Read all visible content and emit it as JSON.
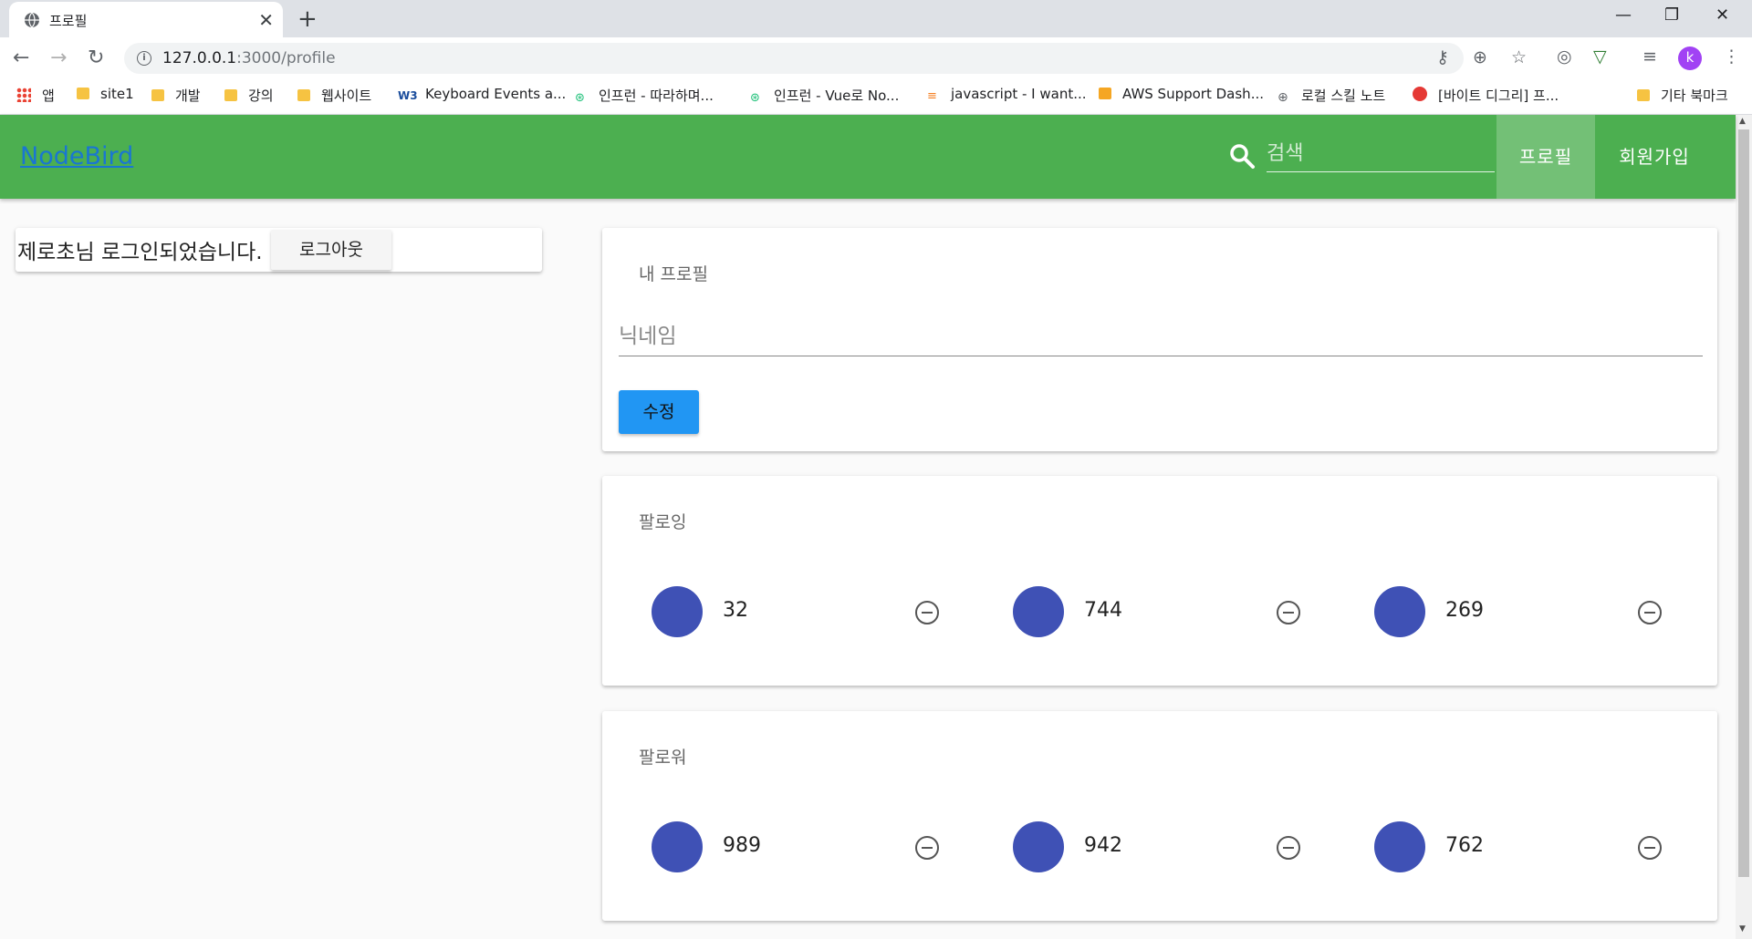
{
  "browser": {
    "tab_title": "프로필",
    "url_host": "127.0.0.1",
    "url_path": ":3000/profile",
    "profile_initial": "k",
    "bookmarks": [
      {
        "label": "앱",
        "icon": "apps-grid-icon"
      },
      {
        "label": "site1",
        "icon": "folder-icon"
      },
      {
        "label": "개발",
        "icon": "folder-icon"
      },
      {
        "label": "강의",
        "icon": "folder-icon"
      },
      {
        "label": "웹사이트",
        "icon": "folder-icon"
      },
      {
        "label": "Keyboard Events a...",
        "icon": "w3-icon"
      },
      {
        "label": "인프런 - 따라하며...",
        "icon": "inflearn-icon"
      },
      {
        "label": "인프런 - Vue로 No...",
        "icon": "inflearn-icon"
      },
      {
        "label": "javascript - I want...",
        "icon": "stackoverflow-icon"
      },
      {
        "label": "AWS Support Dash...",
        "icon": "aws-icon"
      },
      {
        "label": "로컬 스킬 노트",
        "icon": "globe-icon"
      },
      {
        "label": "[바이트 디그리] 프...",
        "icon": "bytedegree-icon"
      },
      {
        "label": "기타 북마크",
        "icon": "folder-icon"
      }
    ]
  },
  "header": {
    "brand": "NodeBird",
    "search_placeholder": "검색",
    "nav_profile": "프로필",
    "nav_signup": "회원가입",
    "accent_color": "#4caf50"
  },
  "login": {
    "message": "제로초님 로그인되었습니다.",
    "logout_label": "로그아웃"
  },
  "profile": {
    "title": "내 프로필",
    "nickname_placeholder": "닉네임",
    "edit_label": "수정",
    "edit_color": "#2196f3"
  },
  "following": {
    "title": "팔로잉",
    "items": [
      "32",
      "744",
      "269"
    ]
  },
  "followers": {
    "title": "팔로워",
    "items": [
      "989",
      "942",
      "762"
    ]
  }
}
